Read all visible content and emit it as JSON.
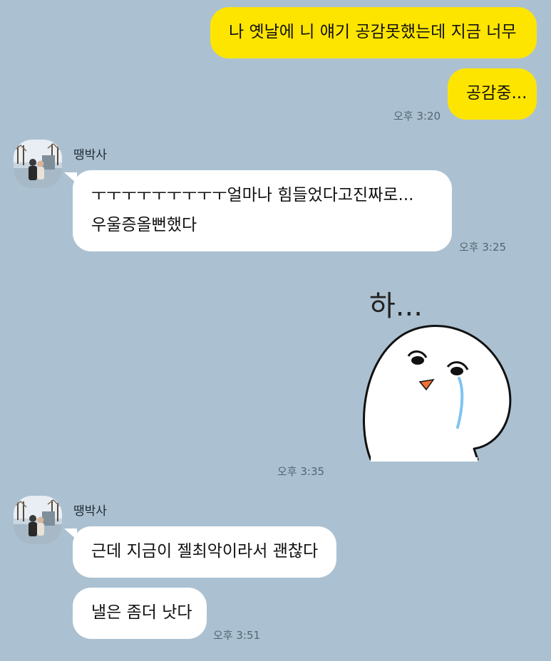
{
  "colors": {
    "background": "#abc1d1",
    "my_bubble": "#fee500",
    "their_bubble": "#ffffff",
    "time_text": "#556572"
  },
  "messages": [
    {
      "from": "me",
      "lines": [
        "나 옛날에 니 얘기 공감못했는데 지금 너무"
      ]
    },
    {
      "from": "me",
      "lines": [
        "공감중..."
      ],
      "time": "오후 3:20"
    },
    {
      "from": "them",
      "sender": "땡박사",
      "lines": [
        "ㅜㅜㅜㅜㅜㅜㅜㅜㅜ얼마나 힘들었다고진짜로...",
        "우울증올뻔했다"
      ],
      "time": "오후 3:25"
    },
    {
      "from": "me",
      "sticker": {
        "icon": "crying-snowman-sticker-icon",
        "text": "하..."
      },
      "time": "오후 3:35"
    },
    {
      "from": "them",
      "sender": "땡박사",
      "lines": [
        "근데 지금이 젤최악이라서 괜찮다"
      ]
    },
    {
      "from": "them",
      "lines": [
        "낼은 좀더 낫다"
      ],
      "time": "오후 3:51"
    }
  ]
}
